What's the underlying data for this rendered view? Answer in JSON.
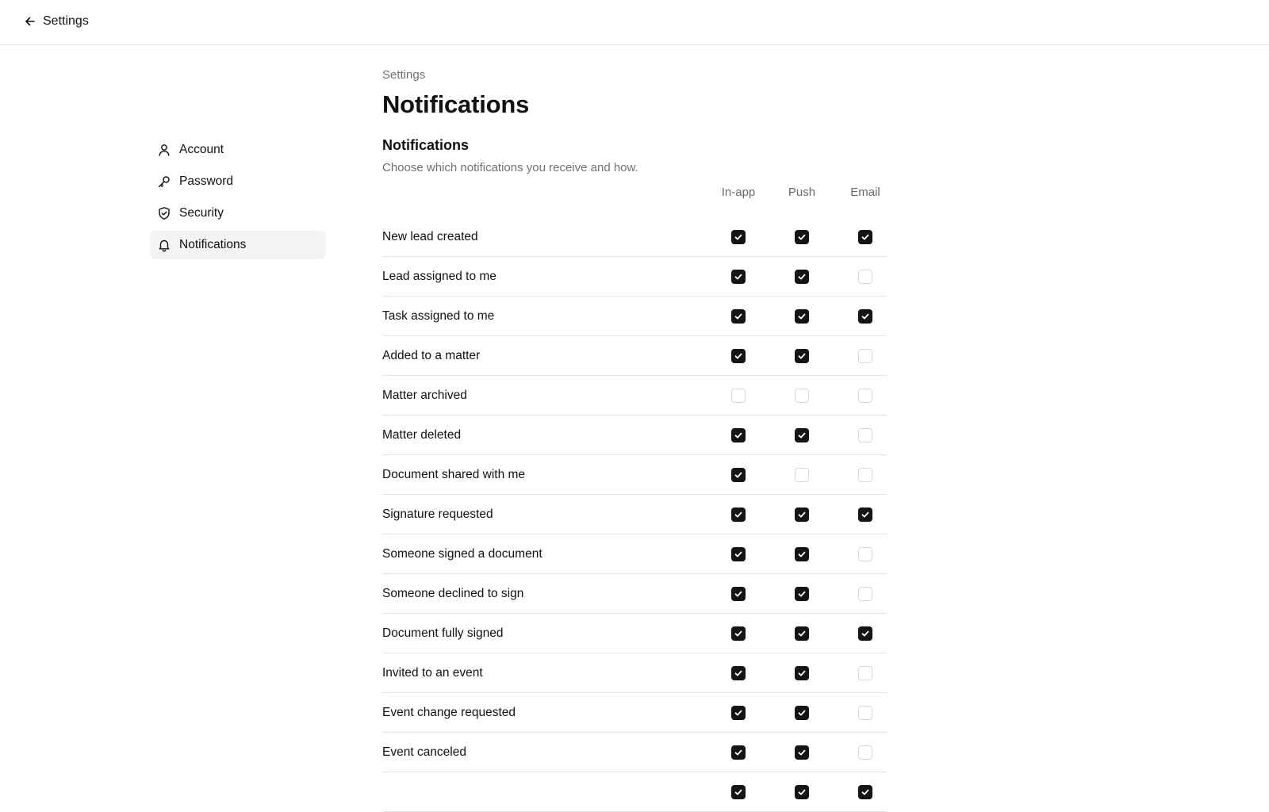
{
  "header": {
    "back_icon": "arrow-left-icon",
    "title": "Settings"
  },
  "sidebar": {
    "items": [
      {
        "label": "Account",
        "icon": "user-icon",
        "active": false
      },
      {
        "label": "Password",
        "icon": "key-icon",
        "active": false
      },
      {
        "label": "Security",
        "icon": "shield-check-icon",
        "active": false
      },
      {
        "label": "Notifications",
        "icon": "bell-icon",
        "active": true
      }
    ]
  },
  "main": {
    "breadcrumb": "Settings",
    "title": "Notifications",
    "section_title": "Notifications",
    "section_description": "Choose which notifications you receive and how.",
    "columns": [
      "In-app",
      "Push",
      "Email"
    ],
    "rows": [
      {
        "label": "New lead created",
        "in_app": true,
        "push": true,
        "email": true
      },
      {
        "label": "Lead assigned to me",
        "in_app": true,
        "push": true,
        "email": false
      },
      {
        "label": "Task assigned to me",
        "in_app": true,
        "push": true,
        "email": true
      },
      {
        "label": "Added to a matter",
        "in_app": true,
        "push": true,
        "email": false
      },
      {
        "label": "Matter archived",
        "in_app": false,
        "push": false,
        "email": false
      },
      {
        "label": "Matter deleted",
        "in_app": true,
        "push": true,
        "email": false
      },
      {
        "label": "Document shared with me",
        "in_app": true,
        "push": false,
        "email": false
      },
      {
        "label": "Signature requested",
        "in_app": true,
        "push": true,
        "email": true
      },
      {
        "label": "Someone signed a document",
        "in_app": true,
        "push": true,
        "email": false
      },
      {
        "label": "Someone declined to sign",
        "in_app": true,
        "push": true,
        "email": false
      },
      {
        "label": "Document fully signed",
        "in_app": true,
        "push": true,
        "email": true
      },
      {
        "label": "Invited to an event",
        "in_app": true,
        "push": true,
        "email": false
      },
      {
        "label": "Event change requested",
        "in_app": true,
        "push": true,
        "email": false
      },
      {
        "label": "Event canceled",
        "in_app": true,
        "push": true,
        "email": false
      },
      {
        "label": "",
        "in_app": true,
        "push": true,
        "email": true
      }
    ]
  },
  "colors": {
    "checked": "#141414",
    "unchecked_border": "#dadada",
    "divider": "#e6e6e6",
    "muted_text": "#707070",
    "active_nav_bg": "#f3f3f3"
  }
}
